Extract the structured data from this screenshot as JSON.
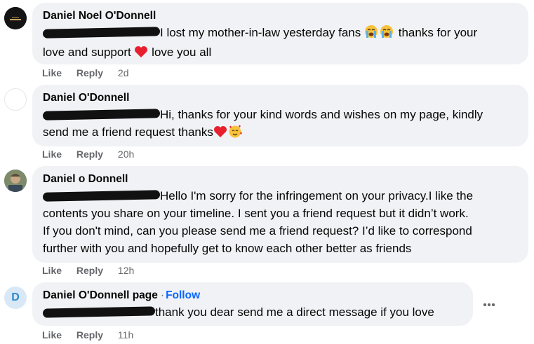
{
  "comments": [
    {
      "author": "Daniel Noel O'Donnell",
      "text_line1": "I lost my mother-in-law yesterday fans",
      "text_line1_tail": "thanks for your",
      "text_line2_a": "love and support",
      "text_line2_b": "love you all",
      "like": "Like",
      "reply": "Reply",
      "time": "2d"
    },
    {
      "author": "Daniel O'Donnell",
      "text_line1": "Hi, thanks for your kind words and wishes on my page, kindly",
      "text_line2": "send me a friend request thanks",
      "like": "Like",
      "reply": "Reply",
      "time": "20h"
    },
    {
      "author": "Daniel o Donnell",
      "text_line1": "Hello I'm sorry for the infringement on your privacy.I like the",
      "text_line2": "contents you share on your timeline. I sent you a friend request but it didn’t work.",
      "text_line3": "If you don't mind, can you please send me a friend request? I’d like to correspond",
      "text_line4": "further with you and hopefully get to know each other better as friends",
      "like": "Like",
      "reply": "Reply",
      "time": "12h"
    },
    {
      "author": "Daniel O'Donnell page",
      "separator": "·",
      "follow": "Follow",
      "avatar_letter": "D",
      "text_line1": "thank you dear send me a direct message if you love",
      "like": "Like",
      "reply": "Reply",
      "time": "11h"
    }
  ],
  "icons": {
    "crying": "loudly-crying-face",
    "heart": "red-heart",
    "hearts_face": "smiling-face-with-hearts",
    "more": "more-options"
  },
  "colors": {
    "bubble": "#f0f2f5",
    "meta": "#65676b",
    "link": "#0866ff",
    "avatar_d_bg": "#d8e8f6",
    "avatar_d_fg": "#2d88c9"
  }
}
